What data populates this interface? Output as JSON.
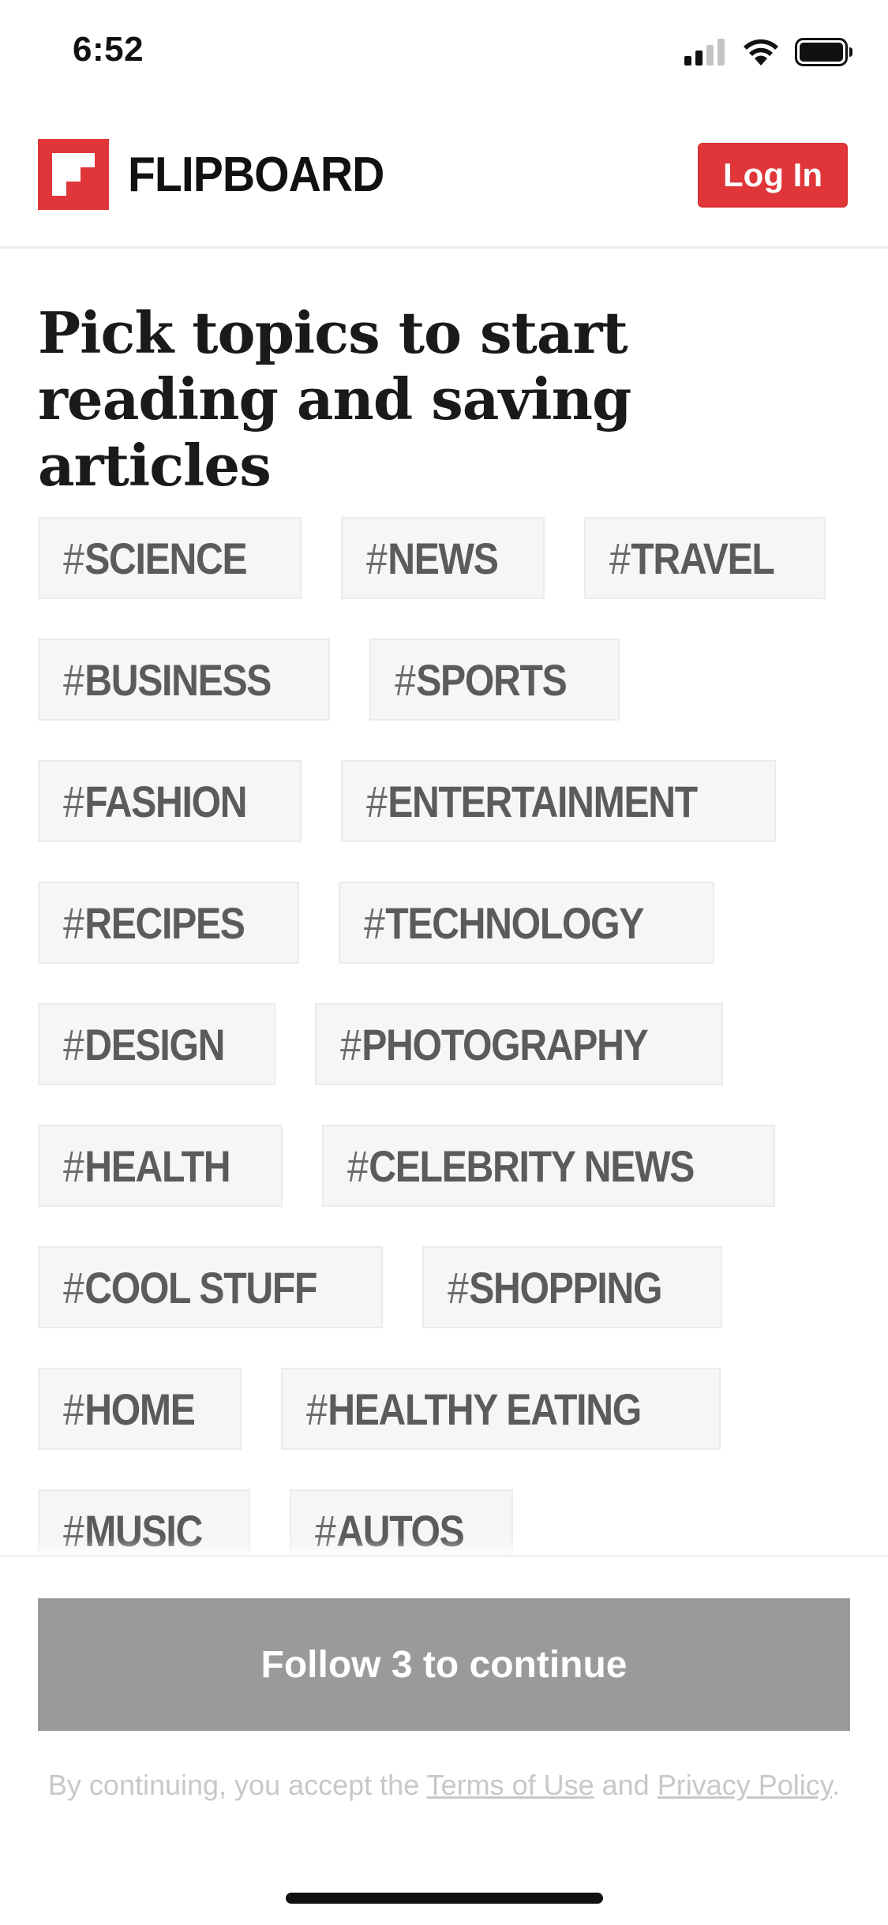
{
  "status_bar": {
    "time": "6:52",
    "icons": [
      "cellular-signal-icon",
      "wifi-icon",
      "battery-icon"
    ]
  },
  "header": {
    "brand_name": "FLIPBOARD",
    "login_label": "Log In"
  },
  "headline": "Pick topics to start reading and saving articles",
  "topic_rows": [
    [
      "SCIENCE",
      "NEWS",
      "TRAVEL"
    ],
    [
      "BUSINESS",
      "SPORTS"
    ],
    [
      "FASHION",
      "ENTERTAINMENT"
    ],
    [
      "RECIPES",
      "TECHNOLOGY"
    ],
    [
      "DESIGN",
      "PHOTOGRAPHY"
    ],
    [
      "HEALTH",
      "CELEBRITY NEWS"
    ],
    [
      "COOL STUFF",
      "SHOPPING"
    ],
    [
      "HOME",
      "HEALTHY EATING"
    ],
    [
      "MUSIC",
      "AUTOS"
    ]
  ],
  "topic_prefix": "#",
  "footer": {
    "continue_label": "Follow 3 to continue",
    "legal_prefix": "By continuing, you accept the ",
    "terms_label": "Terms of Use",
    "legal_and": " and ",
    "privacy_label": "Privacy Policy",
    "legal_suffix": "."
  },
  "colors": {
    "brand_red": "#e0363a",
    "chip_background": "#f6f6f6",
    "chip_text": "#5b5b5b",
    "disabled_button": "#9a9a9a"
  }
}
